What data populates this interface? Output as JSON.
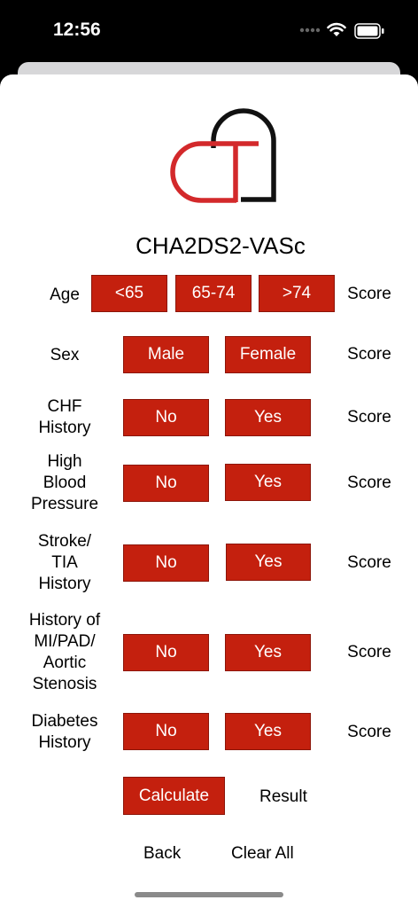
{
  "status_bar": {
    "time": "12:56"
  },
  "title": "CHA2DS2-VASc",
  "rows": {
    "age": {
      "label": "Age",
      "options": [
        "<65",
        "65-74",
        ">74"
      ],
      "score": "Score"
    },
    "sex": {
      "label": "Sex",
      "options": [
        "Male",
        "Female"
      ],
      "score": "Score"
    },
    "chf": {
      "label_lines": [
        "CHF",
        "History"
      ],
      "options": [
        "No",
        "Yes"
      ],
      "score": "Score"
    },
    "hbp": {
      "label_lines": [
        "High",
        "Blood",
        "Pressure"
      ],
      "options": [
        "No",
        "Yes"
      ],
      "score": "Score"
    },
    "stroke": {
      "label_lines": [
        "Stroke/",
        "TIA",
        "History"
      ],
      "options": [
        "No",
        "Yes"
      ],
      "score": "Score"
    },
    "mi": {
      "label_lines": [
        "History of",
        "MI/PAD/",
        "Aortic",
        "Stenosis"
      ],
      "options": [
        "No",
        "Yes"
      ],
      "score": "Score"
    },
    "diabetes": {
      "label_lines": [
        "Diabetes",
        "History"
      ],
      "options": [
        "No",
        "Yes"
      ],
      "score": "Score"
    }
  },
  "actions": {
    "calculate": "Calculate",
    "result": "Result",
    "back": "Back",
    "clear_all": "Clear All"
  },
  "colors": {
    "button": "#c4200e",
    "logo_red": "#d3292b",
    "logo_black": "#111111"
  }
}
